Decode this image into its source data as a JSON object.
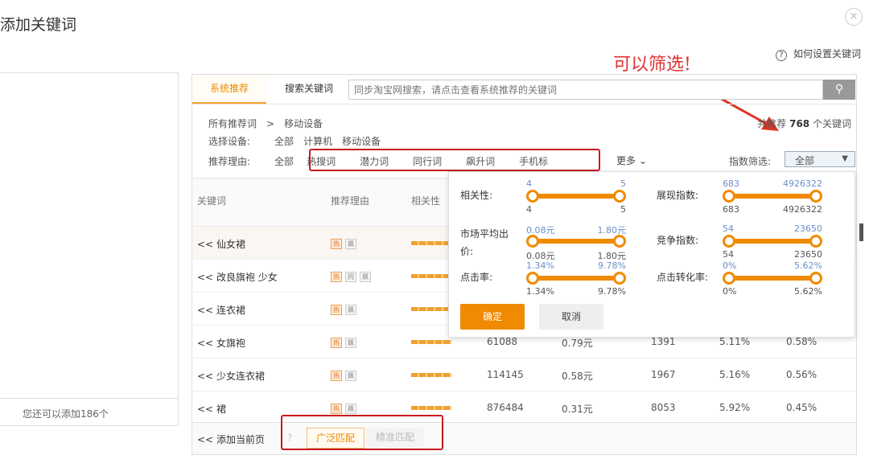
{
  "dialog": {
    "title": "添加关键词",
    "close": "×",
    "help": "如何设置关键词",
    "help_icon": "?"
  },
  "annotation": "可以筛选!",
  "left_panel": {
    "remaining": "您还可以添加186个"
  },
  "tabs": {
    "recommend": "系统推荐",
    "search": "搜索关键词"
  },
  "search": {
    "placeholder": "同步淘宝网搜索，请点击查看系统推荐的关键词",
    "icon": "search-icon"
  },
  "breadcrumb": {
    "root": "所有推荐词",
    "sep": ">",
    "current": "移动设备"
  },
  "count": {
    "prefix": "共推荐",
    "value": "768",
    "suffix": "个关键词"
  },
  "device": {
    "label": "选择设备:",
    "options": [
      "全部",
      "计算机",
      "移动设备"
    ]
  },
  "reason": {
    "label": "推荐理由:",
    "all": "全部",
    "options": [
      "热搜词",
      "潜力词",
      "同行词",
      "飙升词",
      "手机标"
    ],
    "more": "更多"
  },
  "index_filter": {
    "label": "指数筛选:",
    "value": "全部"
  },
  "table": {
    "headers": [
      "关键词",
      "推荐理由",
      "相关性"
    ],
    "rows": [
      {
        "keyword": "仙女裙",
        "badges": [
          "热",
          "飙"
        ]
      },
      {
        "keyword": "改良旗袍 少女",
        "badges": [
          "热",
          "同",
          "飙"
        ]
      },
      {
        "keyword": "连衣裙",
        "badges": [
          "热",
          "飙"
        ]
      },
      {
        "keyword": "女旗袍",
        "badges": [
          "热",
          "飙"
        ],
        "values": [
          "61088",
          "0.79元",
          "1391",
          "5.11%",
          "0.58%"
        ]
      },
      {
        "keyword": "少女连衣裙",
        "badges": [
          "热",
          "飙"
        ],
        "values": [
          "114145",
          "0.58元",
          "1967",
          "5.16%",
          "0.56%"
        ]
      },
      {
        "keyword": "裙",
        "badges": [
          "热",
          "飙"
        ],
        "values": [
          "876484",
          "0.31元",
          "8053",
          "5.92%",
          "0.45%"
        ]
      }
    ],
    "row_prefix": "<<"
  },
  "footer": {
    "add_page": "添加当前页",
    "broad": "广泛匹配",
    "exact": "精准匹配"
  },
  "popup": {
    "sliders": [
      {
        "label": "相关性:",
        "min": "4",
        "max": "5"
      },
      {
        "label": "展现指数:",
        "min": "683",
        "max": "4926322"
      },
      {
        "label": "市场平均出价:",
        "min": "0.08元",
        "max": "1.80元"
      },
      {
        "label": "竞争指数:",
        "min": "54",
        "max": "23650"
      },
      {
        "label": "点击率:",
        "min": "1.34%",
        "max": "9.78%"
      },
      {
        "label": "点击转化率:",
        "min": "0%",
        "max": "5.62%"
      }
    ],
    "ok": "确定",
    "cancel": "取消"
  },
  "colors": {
    "accent": "#f08a00",
    "annotation": "#c8191e"
  }
}
